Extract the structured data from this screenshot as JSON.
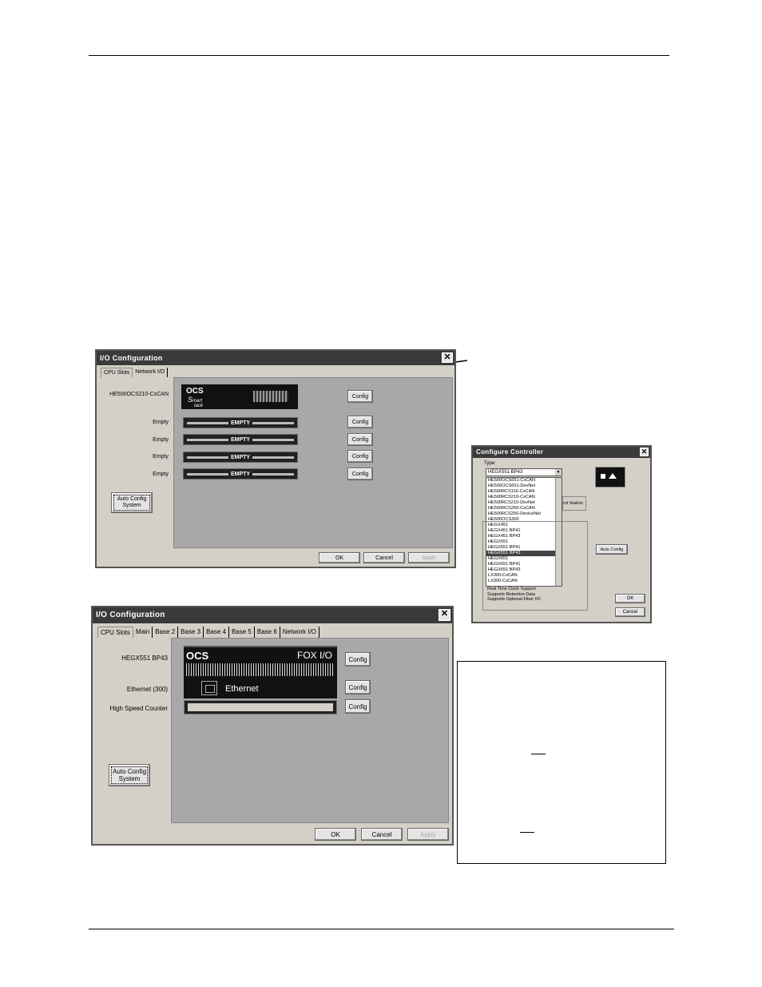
{
  "dialog1": {
    "title": "I/O Configuration",
    "tabs": [
      "CPU Slots",
      "Network I/O"
    ],
    "slots": [
      {
        "label": "HE500OCS210-CsCAN",
        "module": "OCS",
        "config": "Config"
      },
      {
        "label": "Empty",
        "module": "EMPTY",
        "config": "Config"
      },
      {
        "label": "Empty",
        "module": "EMPTY",
        "config": "Config"
      },
      {
        "label": "Empty",
        "module": "EMPTY",
        "config": "Config"
      },
      {
        "label": "Empty",
        "module": "EMPTY",
        "config": "Config"
      }
    ],
    "logo_text": "mart",
    "logo_text2": "tack",
    "auto_config": "Auto Config System",
    "ok": "OK",
    "cancel": "Cancel",
    "apply": "Apply"
  },
  "dialog2": {
    "title": "Configure Controller",
    "type_label": "Type:",
    "selected": "HEGX551 BP43",
    "options": [
      "HE500OCS651-CsCAN",
      "HE500OCS651-DevNet",
      "HE500RCS116-CsCAN",
      "HE500RCS210-CsCAN",
      "HE500RCS210-DevNet",
      "HE500RCS250-CsCAN",
      "HE500RCS250-DeviceNet",
      "HE500OCS300",
      "HEGX451",
      "HEGX451 BP41",
      "HEGX451 BP43",
      "HEGX551",
      "HEGX551 BP41",
      "HEGX551 BP43",
      "HEGX651",
      "HEGX651 BP41",
      "HEGX651 BP43",
      "LX300-CsCAN",
      "LX300-CsCAN"
    ],
    "remote_station": "rol Station",
    "auto_config": "Auto Config",
    "features": [
      "Real Time Clock Support",
      "Supports Retentive Data",
      "Supports Optional Fiber I/O"
    ],
    "ok": "OK",
    "cancel": "Cancel"
  },
  "dialog3": {
    "title": "I/O Configuration",
    "tabs": [
      "CPU Slots",
      "Main",
      "Base 2",
      "Base 3",
      "Base 4",
      "Base 5",
      "Base 6",
      "Network I/O"
    ],
    "rows": [
      {
        "label": "HEGX551 BP43",
        "config": "Config"
      },
      {
        "label": "Ethernet (300)",
        "config": "Config"
      },
      {
        "label": "High Speed Counter",
        "config": "Config"
      }
    ],
    "module_title": "OCS",
    "module_fox": "FOX I/O",
    "ethernet": "Ethernet",
    "auto_config": "Auto Config System",
    "ok": "OK",
    "cancel": "Cancel",
    "apply": "Apply"
  }
}
